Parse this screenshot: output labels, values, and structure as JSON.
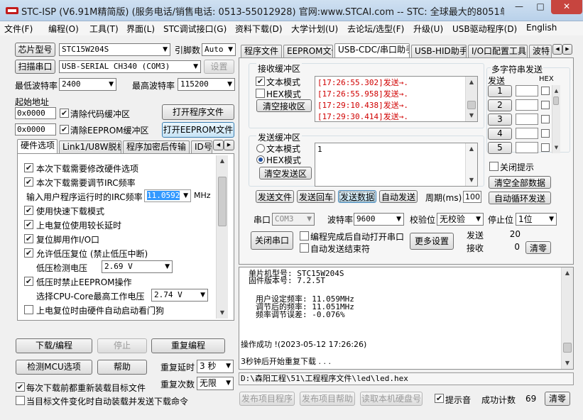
{
  "app": {
    "title": "STC-ISP (V6.91M精简版) (服务电话/销售电话: 0513-55012928) 官网:www.STCAI.com -- STC: 全球最大的8051单片机设..."
  },
  "window": {
    "minimize": "—",
    "maximize": "□",
    "close": "✕"
  },
  "menu": [
    "文件(F)",
    "编程(O)",
    "工具(T)",
    "界面(L)",
    "STC调试接口(G)",
    "资料下载(D)",
    "大学计划(U)",
    "去论坛/选型(F)",
    "升级(U)",
    "USB驱动程序(D)",
    "English"
  ],
  "left": {
    "chip_label": "芯片型号",
    "chip_value": "STC15W204S",
    "pins_label": "引脚数",
    "pins_value": "Auto",
    "scan_label": "扫描串口",
    "port_value": "USB-SERIAL CH340 (COM3)",
    "settings_label": "设置",
    "min_baud_label": "最低波特率",
    "min_baud_value": "2400",
    "max_baud_label": "最高波特率",
    "max_baud_value": "115200",
    "start_addr_label": "起始地址",
    "addr1": "0x0000",
    "clear_code": "清除代码缓冲区",
    "open_prog": "打开程序文件",
    "addr2": "0x0000",
    "clear_eeprom": "清除EEPROM缓冲区",
    "open_eeprom": "打开EEPROM文件",
    "tabs": [
      "硬件选项",
      "Link1/U8W脱机",
      "程序加密后传输",
      "ID号"
    ],
    "options": [
      {
        "label": "本次下载需要修改硬件选项",
        "checked": true
      },
      {
        "label": "本次下载需要调节IRC频率",
        "checked": true
      },
      {
        "label": "输入用户程序运行时的IRC频率",
        "checked": null
      },
      {
        "label": "使用快速下载模式",
        "checked": true
      },
      {
        "label": "上电复位使用较长延时",
        "checked": true
      },
      {
        "label": "复位脚用作I/O口",
        "checked": true
      },
      {
        "label": "允许低压复位 (禁止低压中断)",
        "checked": true
      },
      {
        "label": "低压检测电压",
        "checked": null
      },
      {
        "label": "低压时禁止EEPROM操作",
        "checked": true
      },
      {
        "label": "选择CPU-Core最高工作电压",
        "checked": null
      },
      {
        "label": "上电复位时由硬件自动启动看门狗",
        "checked": false
      }
    ],
    "irc_value": "11.0592",
    "irc_unit": "MHz",
    "lvd_value": "2.69 V",
    "core_value": "2.74 V",
    "download": "下载/编程",
    "stop": "停止",
    "reprogram": "重复编程",
    "detect": "检测MCU选项",
    "help": "帮助",
    "delay_label": "重复延时",
    "delay_value": "3 秒",
    "count_label": "重复次数",
    "count_value": "无限",
    "reload": "每次下载前都重新装载目标文件",
    "auto_send": "当目标文件变化时自动装载并发送下载命令"
  },
  "right": {
    "tabs": [
      "程序文件",
      "EEPROM文件",
      "USB-CDC/串口助手",
      "USB-HID助手",
      "I/O口配置工具",
      "波特"
    ],
    "recv_title": "接收缓冲区",
    "text_mode": "文本模式",
    "hex_mode": "HEX模式",
    "clear_recv": "清空接收区",
    "recv_lines": [
      "[17:26:55.302]发送→.",
      "[17:26:55.958]发送→.",
      "[17:29:10.438]发送→.",
      "[17:29:30.414]发送→."
    ],
    "send_title": "发送缓冲区",
    "send_text": "1",
    "clear_send": "清空发送区",
    "send_file": "发送文件",
    "send_return": "发送回车",
    "send_data": "发送数据",
    "auto_send": "自动发送",
    "period_label": "周期(ms)",
    "period_value": "100",
    "multi_title": "多字符串发送",
    "send_col": "发送",
    "hex_col": "HEX",
    "multi": [
      "1",
      "2",
      "3",
      "4",
      "5"
    ],
    "close_tip": "关闭提示",
    "clear_all": "清空全部数据",
    "auto_cycle": "自动循环发送",
    "port_label": "串口",
    "port_value": "COM3",
    "baud_label": "波特率",
    "baud_value": "9600",
    "parity_label": "校验位",
    "parity_value": "无校验",
    "stop_label": "停止位",
    "stop_value": "1位",
    "close_port": "关闭串口",
    "auto_open": "编程完成后自动打开串口",
    "auto_end": "自动发送结束符",
    "more": "更多设置",
    "tx_label": "发送",
    "tx_value": "20",
    "rx_label": "接收",
    "rx_value": "0",
    "zero": "清零"
  },
  "log": {
    "lines": [
      "单片机型号: STC15W204S",
      "固件版本号: 7.2.5T",
      "",
      "用户设定频率: 11.059MHz",
      "调节后的频率: 11.051MHz",
      "频率调节误差: -0.076%",
      "",
      "",
      "操作成功 !(2023-05-12 17:26:26)",
      "",
      "3秒钟后开始重复下载 . . ."
    ],
    "path": "D:\\森阳工程\\51\\工程程序文件\\led\\led.hex",
    "publish_prog": "发布项目程序",
    "publish_help": "发布项目帮助",
    "read_disk": "读取本机硬盘号",
    "tip_sound": "提示音",
    "success_label": "成功计数",
    "success_value": "69",
    "clear": "清零"
  },
  "colors": {
    "accent": "#1f4fa0",
    "red_text": "#d00000",
    "title_bar": "#bcd3ec"
  }
}
